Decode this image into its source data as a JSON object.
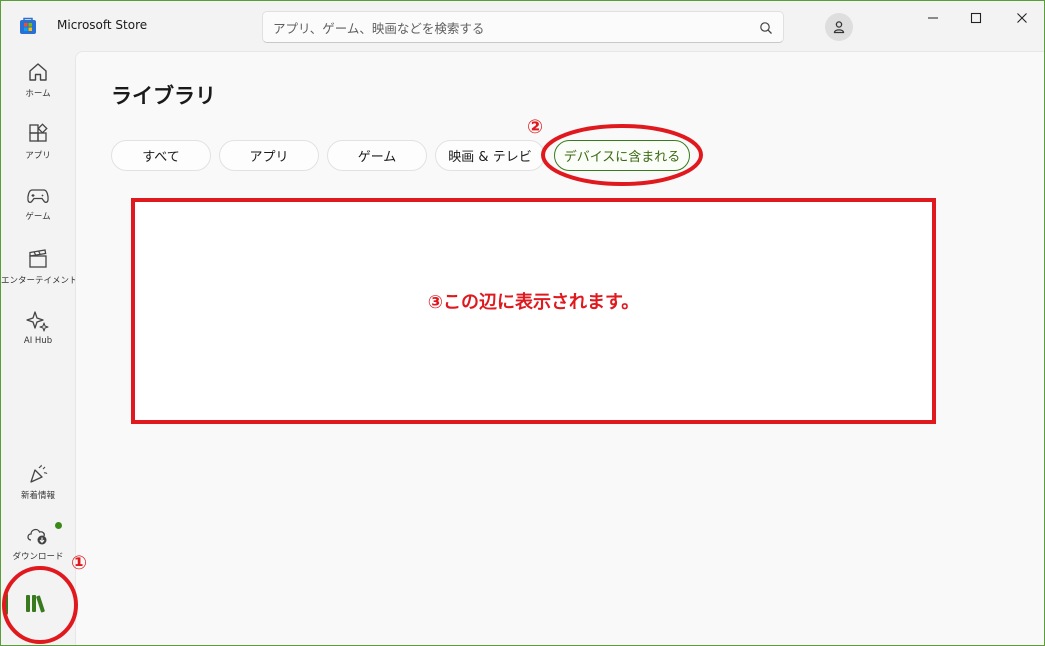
{
  "app": {
    "title": "Microsoft Store"
  },
  "search": {
    "placeholder": "アプリ、ゲーム、映画などを検索する"
  },
  "sidebar": {
    "items": [
      {
        "label": "ホーム"
      },
      {
        "label": "アプリ"
      },
      {
        "label": "ゲーム"
      },
      {
        "label": "エンターテイメント"
      },
      {
        "label": "AI Hub"
      },
      {
        "label": "新着情報"
      },
      {
        "label": "ダウンロード"
      }
    ]
  },
  "main": {
    "title": "ライブラリ",
    "tabs": [
      {
        "label": "すべて"
      },
      {
        "label": "アプリ"
      },
      {
        "label": "ゲーム"
      },
      {
        "label": "映画 & テレビ"
      },
      {
        "label": "デバイスに含まれる",
        "selected": true
      }
    ]
  },
  "annotations": {
    "one": "①",
    "two": "②",
    "three_text": "③この辺に表示されます。"
  },
  "colors": {
    "accent": "#3a7a1e",
    "annotation": "#e0191f",
    "badge": "#3a8a1a"
  }
}
